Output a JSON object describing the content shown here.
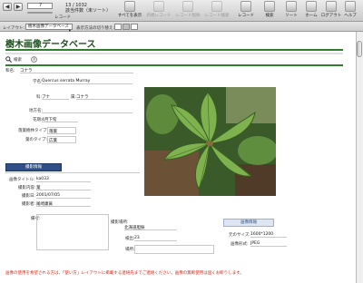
{
  "toolbar": {
    "record_number": "7",
    "record_label": "レコード",
    "found_count": "13 / 1032",
    "found_status": "該当件数（未ソート）",
    "buttons": [
      {
        "label": "すべてを表示",
        "enabled": true
      },
      {
        "label": "新規レコード",
        "enabled": false
      },
      {
        "label": "レコード削除",
        "enabled": false
      },
      {
        "label": "レコード検索",
        "enabled": false
      },
      {
        "label": "レコード",
        "enabled": true
      },
      {
        "label": "検索",
        "enabled": true
      },
      {
        "label": "ソート",
        "enabled": true
      },
      {
        "label": "ホーム",
        "enabled": true
      },
      {
        "label": "ログアウト",
        "enabled": true
      },
      {
        "label": "ヘルプ",
        "enabled": true
      }
    ]
  },
  "statusbar": {
    "layout_label": "レイアウト:",
    "layout_value": "樹木画像データベース",
    "view_label": "表示方法の切り替え:"
  },
  "page": {
    "title": "樹木画像データベース",
    "links": [
      {
        "label": "検索",
        "icon": "search-icon"
      },
      {
        "label": "",
        "icon": "help-icon"
      }
    ]
  },
  "record": {
    "wamei_label": "和名:",
    "wamei": "コナラ",
    "gakumei_label": "学名:",
    "gakumei": "Quercus serrata Murray",
    "ka_label": "科:",
    "ka": "ブナ",
    "zoku_label": "属:",
    "zoku": "コナラ",
    "chiho_label": "地方名:",
    "kaiki_label": "花期:",
    "kaiki": "4月下旬",
    "yoki_label": "落葉樹林タイプ:",
    "yoki": "落葉",
    "ha_label": "葉のタイプ:",
    "ha": "広葉"
  },
  "photo_section": {
    "button": "撮影情報",
    "image_title_label": "画像タイトル:",
    "image_title": "ka033",
    "content_label": "撮影内容:",
    "content": "葉",
    "date_label": "撮影日:",
    "date": "2001/07/05",
    "person_label": "撮影者:",
    "person": "尾崎康眞",
    "remarks_label": "備考:",
    "location_label": "撮影場所:",
    "location": "北海道胆振",
    "size_label": "検出:",
    "size": "23",
    "place_label": "場所:"
  },
  "image_info": {
    "button": "画像情報",
    "dimensions_label": "元のサイズ:",
    "dimensions": "1600*1200",
    "format_label": "画像形式:",
    "format": "JPEG"
  },
  "footer_note": "画像の使用を希望される方は、「使い方」レイアウトに掲載する連絡先までご連絡ください。画像の無断使用は固くお断りします。"
}
